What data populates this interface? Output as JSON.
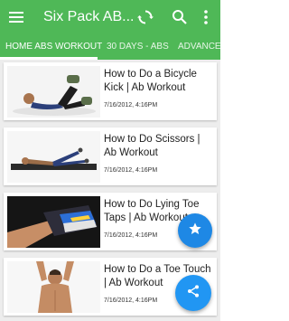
{
  "toolbar": {
    "title": "Six Pack AB...",
    "menu_icon": "hamburger-menu-icon",
    "refresh_icon": "refresh-icon",
    "search_icon": "search-icon",
    "more_icon": "overflow-menu-icon"
  },
  "tabs": [
    {
      "label": "HOME ABS WORKOUT",
      "active": true
    },
    {
      "label": "30 DAYS - ABS",
      "active": false
    },
    {
      "label": "ADVANCED",
      "active": false
    }
  ],
  "videos": [
    {
      "title": "How to Do a Bicycle Kick | Ab Workout",
      "time": "7/16/2012, 4:16PM"
    },
    {
      "title": "How to Do Scissors | Ab Workout",
      "time": "7/16/2012, 4:16PM"
    },
    {
      "title": "How to Do Lying Toe Taps | Ab Workout",
      "time": "7/16/2012, 4:16PM"
    },
    {
      "title": "How to Do a Toe Touch | Ab Workout",
      "time": "7/16/2012, 4:16PM"
    }
  ],
  "fabs": {
    "favorite_icon": "star-icon",
    "share_icon": "share-icon"
  },
  "colors": {
    "appbar": "#4fb857",
    "fab": "#2196f3"
  }
}
